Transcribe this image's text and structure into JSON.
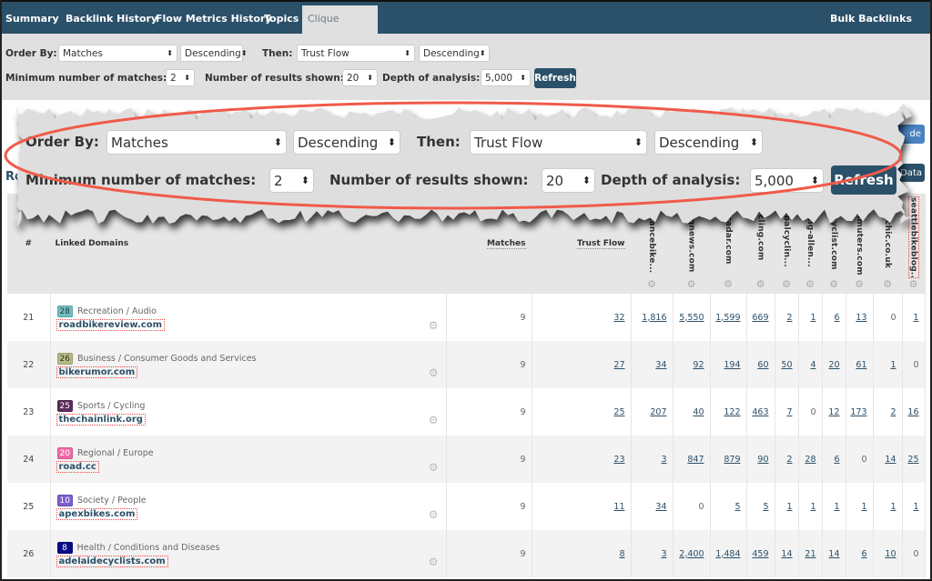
{
  "nav": {
    "tabs": [
      "Summary",
      "Backlink History",
      "Flow Metrics History",
      "Topics",
      "Clique Hunter"
    ],
    "active_tab": "Clique Hunter",
    "right_link": "Bulk Backlinks"
  },
  "controls": {
    "order_by_label": "Order By:",
    "order_by": "Matches",
    "order_dir": "Descending",
    "then_label": "Then:",
    "then_by": "Trust Flow",
    "then_dir": "Descending",
    "min_label": "Minimum number of matches:",
    "min_matches": "2",
    "results_label": "Number of results shown:",
    "results": "20",
    "depth_label": "Depth of analysis:",
    "depth": "5,000",
    "refresh": "Refresh"
  },
  "partial": {
    "left_text": "Re",
    "button_1": "de",
    "button_2": "Data"
  },
  "table": {
    "headers": {
      "num": "#",
      "domains": "Linked Domains",
      "matches": "Matches",
      "trust_flow": "Trust Flow"
    },
    "domain_columns": [
      "ormancebike...",
      "clingnews.com",
      "eradar.com",
      "cling.com",
      "lobalcyclin...",
      "cling-allen...",
      "nkcyclist.com",
      "commuters.com",
      "clechic.co.uk",
      "seattlebikeblog..."
    ],
    "rows": [
      {
        "num": "21",
        "tf_score": "28",
        "badge_color": "#6fc0c3",
        "category": "Recreation / Audio",
        "domain": "roadbikereview.com",
        "matches": "9",
        "trust_flow": "32",
        "values": [
          "1,816",
          "5,550",
          "1,599",
          "669",
          "2",
          "1",
          "6",
          "13",
          "0",
          "1"
        ]
      },
      {
        "num": "22",
        "tf_score": "26",
        "badge_color": "#b8bb7f",
        "category": "Business / Consumer Goods and Services",
        "domain": "bikerumor.com",
        "matches": "9",
        "trust_flow": "27",
        "values": [
          "34",
          "92",
          "194",
          "60",
          "50",
          "4",
          "20",
          "61",
          "1",
          "0"
        ]
      },
      {
        "num": "23",
        "tf_score": "25",
        "badge_color": "#5a2d5b",
        "category": "Sports / Cycling",
        "domain": "thechainlink.org",
        "matches": "9",
        "trust_flow": "25",
        "values": [
          "207",
          "40",
          "122",
          "463",
          "7",
          "0",
          "12",
          "173",
          "2",
          "16"
        ]
      },
      {
        "num": "24",
        "tf_score": "20",
        "badge_color": "#f06aa8",
        "category": "Regional / Europe",
        "domain": "road.cc",
        "matches": "9",
        "trust_flow": "23",
        "values": [
          "3",
          "847",
          "879",
          "90",
          "2",
          "28",
          "6",
          "0",
          "14",
          "25"
        ]
      },
      {
        "num": "25",
        "tf_score": "10",
        "badge_color": "#7b5fcf",
        "category": "Society / People",
        "domain": "apexbikes.com",
        "matches": "9",
        "trust_flow": "11",
        "values": [
          "34",
          "0",
          "5",
          "5",
          "1",
          "1",
          "1",
          "1",
          "1",
          "1"
        ]
      },
      {
        "num": "26",
        "tf_score": "8",
        "badge_color": "#0b0b88",
        "category": "Health / Conditions and Diseases",
        "domain": "adelaidecyclists.com",
        "matches": "9",
        "trust_flow": "8",
        "values": [
          "3",
          "2,400",
          "1,484",
          "459",
          "14",
          "21",
          "14",
          "6",
          "10",
          "0"
        ]
      }
    ]
  },
  "colors": {
    "nav_bg": "#2b5069",
    "highlight_ellipse": "#f05a4a",
    "link": "#2b5069"
  }
}
